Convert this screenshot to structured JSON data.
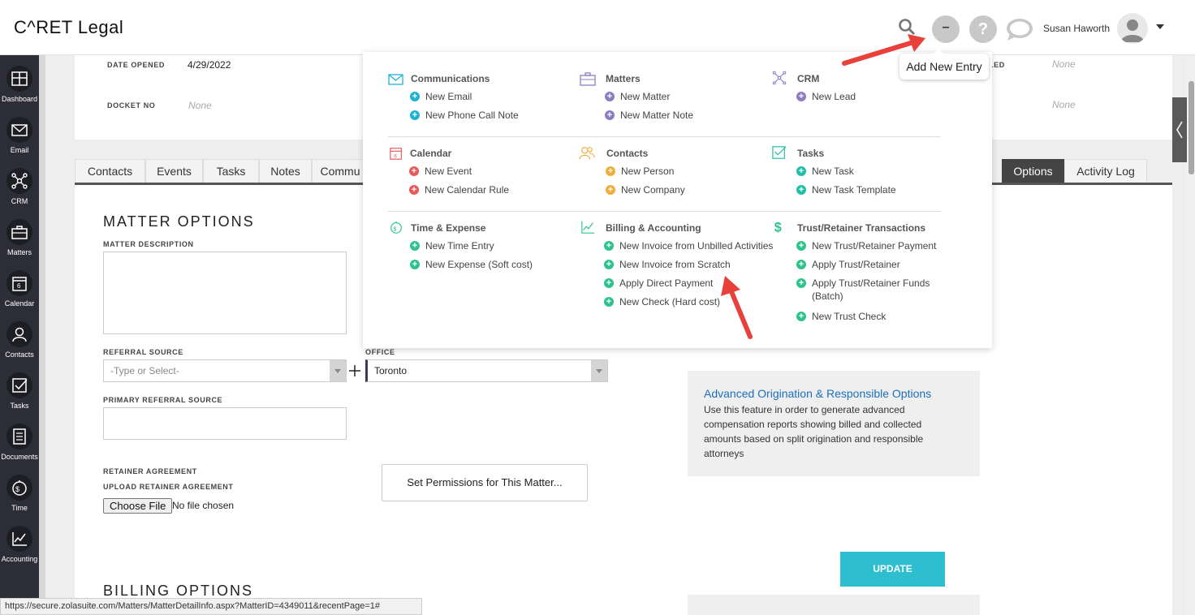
{
  "header": {
    "logo": "C^RET Legal",
    "add_button_symbol": "–",
    "help_symbol": "?",
    "user_name": "Susan Haworth",
    "tooltip": "Add New Entry"
  },
  "sidebar": {
    "items": [
      {
        "label": "Dashboard",
        "icon": "dashboard-icon"
      },
      {
        "label": "Email",
        "icon": "email-icon"
      },
      {
        "label": "CRM",
        "icon": "crm-icon"
      },
      {
        "label": "Matters",
        "icon": "briefcase-icon"
      },
      {
        "label": "Calendar",
        "icon": "calendar-icon"
      },
      {
        "label": "Contacts",
        "icon": "contacts-icon"
      },
      {
        "label": "Tasks",
        "icon": "tasks-icon"
      },
      {
        "label": "Documents",
        "icon": "documents-icon"
      },
      {
        "label": "Time",
        "icon": "time-icon"
      },
      {
        "label": "Accounting",
        "icon": "accounting-icon"
      }
    ]
  },
  "matter_info": {
    "date_opened_label": "DATE OPENED",
    "date_opened": "4/29/2022",
    "docket_no_label": "DOCKET NO",
    "docket_no": "None",
    "right_label": "LED",
    "right_value_1": "None",
    "right_value_2": "None"
  },
  "tabs": [
    "Contacts",
    "Events",
    "Tasks",
    "Notes",
    "Commu",
    "Options",
    "Activity Log"
  ],
  "matter_options": {
    "title": "MATTER OPTIONS",
    "description_label": "MATTER DESCRIPTION",
    "referral_source_label": "REFERRAL SOURCE",
    "referral_placeholder": "-Type or Select-",
    "office_label": "OFFICE",
    "office_value": "Toronto",
    "primary_referral_label": "PRIMARY REFERRAL SOURCE",
    "retainer_label": "RETAINER AGREEMENT",
    "upload_label": "UPLOAD RETAINER AGREEMENT",
    "choose_file": "Choose File",
    "no_file": "No file chosen",
    "permissions_button": "Set Permissions for This Matter...",
    "billing_title": "BILLING OPTIONS"
  },
  "advanced": {
    "link": "Advanced Origination & Responsible Options",
    "description": "Use this feature in order to generate advanced compensation reports showing billed and collected amounts based on split origination and responsible attorneys"
  },
  "update_button": "UPDATE",
  "dropdown": {
    "communications": {
      "title": "Communications",
      "items": [
        "New Email",
        "New Phone Call Note"
      ]
    },
    "matters": {
      "title": "Matters",
      "items": [
        "New Matter",
        "New Matter Note"
      ]
    },
    "crm": {
      "title": "CRM",
      "items": [
        "New Lead"
      ]
    },
    "calendar": {
      "title": "Calendar",
      "items": [
        "New Event",
        "New Calendar Rule"
      ]
    },
    "contacts": {
      "title": "Contacts",
      "items": [
        "New Person",
        "New Company"
      ]
    },
    "tasks": {
      "title": "Tasks",
      "items": [
        "New Task",
        "New Task Template"
      ]
    },
    "time_expense": {
      "title": "Time & Expense",
      "items": [
        "New Time Entry",
        "New Expense (Soft cost)"
      ]
    },
    "billing": {
      "title": "Billing & Accounting",
      "items": [
        "New Invoice from Unbilled Activities",
        "New Invoice from Scratch",
        "Apply Direct Payment",
        "New Check (Hard cost)"
      ]
    },
    "trust": {
      "title": "Trust/Retainer Transactions",
      "items": [
        "New Trust/Retainer Payment",
        "Apply Trust/Retainer",
        "Apply Trust/Retainer Funds",
        "(Batch)",
        "New Trust Check"
      ]
    }
  },
  "colors": {
    "teal": "#1fbfa8",
    "cyan": "#1fb2d3",
    "purple": "#8e7cc3",
    "red": "#e85a5a",
    "orange": "#f0ad3c",
    "green": "#2ec38c"
  },
  "status_bar": "https://secure.zolasuite.com/Matters/MatterDetailInfo.aspx?MatterID=4349011&recentPage=1#"
}
